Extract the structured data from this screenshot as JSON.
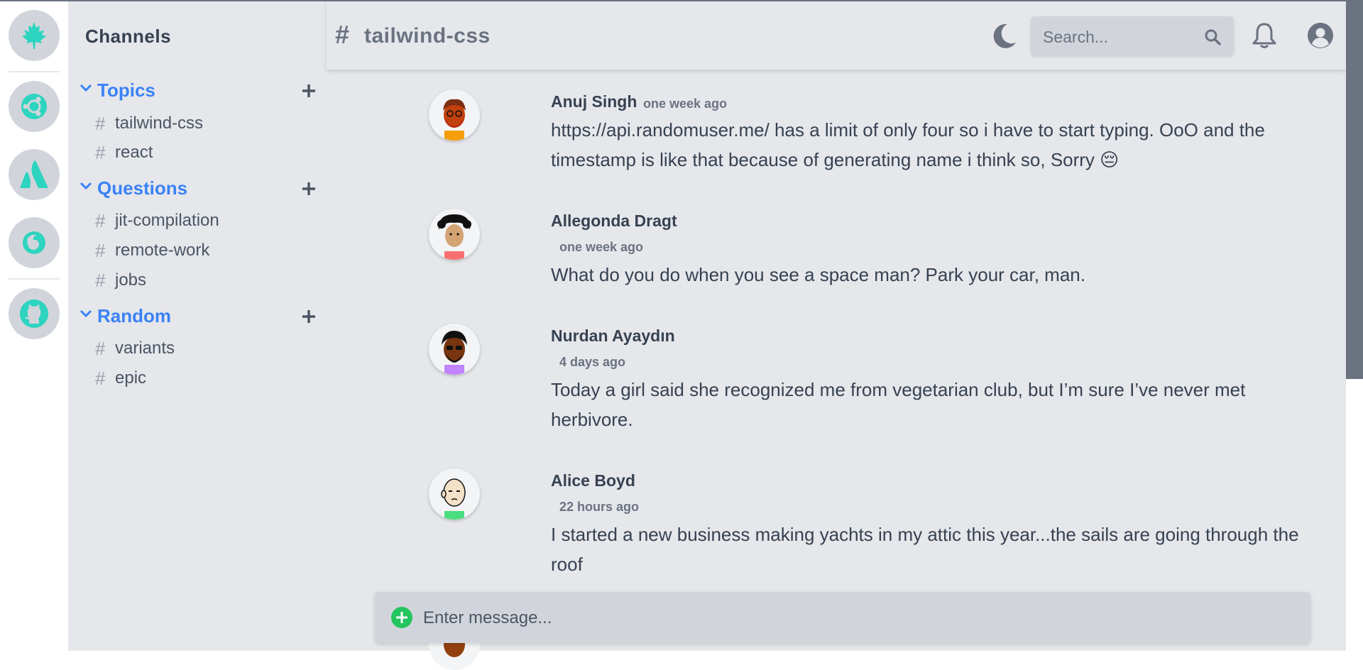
{
  "sidebar": {
    "title": "Channels",
    "groups": [
      {
        "name": "Topics",
        "channels": [
          "tailwind-css",
          "react"
        ]
      },
      {
        "name": "Questions",
        "channels": [
          "jit-compilation",
          "remote-work",
          "jobs"
        ]
      },
      {
        "name": "Random",
        "channels": [
          "variants",
          "epic"
        ]
      }
    ]
  },
  "header": {
    "hash": "#",
    "channel": "tailwind-css",
    "search_placeholder": "Search..."
  },
  "messages": [
    {
      "author": "Anuj Singh",
      "time": "one week ago",
      "text": "https://api.randomuser.me/ has a limit of only four so i have to start typing. OoO and the timestamp is like that because of generating name i think so, Sorry 😔"
    },
    {
      "author": "Allegonda Dragt",
      "time": "one week ago",
      "text": "What do you do when you see a space man? Park your car, man."
    },
    {
      "author": "Nurdan Ayaydın",
      "time": "4 days ago",
      "text": "Today a girl said she recognized me from vegetarian club, but I’m sure I’ve never met herbivore."
    },
    {
      "author": "Alice Boyd",
      "time": "22 hours ago",
      "text": "I started a new business making yachts in my attic this year...the sails are going through the roof"
    }
  ],
  "composer": {
    "placeholder": "Enter message..."
  },
  "colors": {
    "accent": "#3b82f6",
    "server_icon": "#2dd4bf",
    "composer_plus": "#22c55e",
    "icon_gray": "#6b7280"
  },
  "icons": {
    "servers": [
      "maple-leaf-icon",
      "ubuntu-icon",
      "atlassian-icon",
      "firefox-icon",
      "github-icon"
    ]
  }
}
